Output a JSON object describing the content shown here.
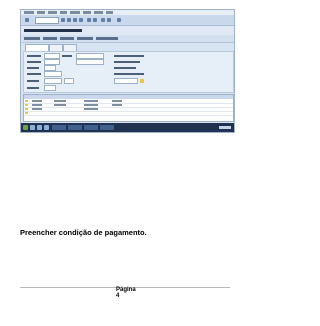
{
  "caption": "Preencher condição de pagamento.",
  "footer": {
    "page_label": "Página",
    "page_number": "4"
  },
  "screenshot": {
    "description_icons": [
      "window-icon",
      "save-icon",
      "back-icon",
      "exit-icon",
      "cancel-icon",
      "print-icon",
      "find-icon",
      "help-icon"
    ]
  },
  "colors": {
    "sap_background": "#d7e4f2",
    "sap_toolbar": "#c9d8ea",
    "taskbar": "#20324f"
  }
}
